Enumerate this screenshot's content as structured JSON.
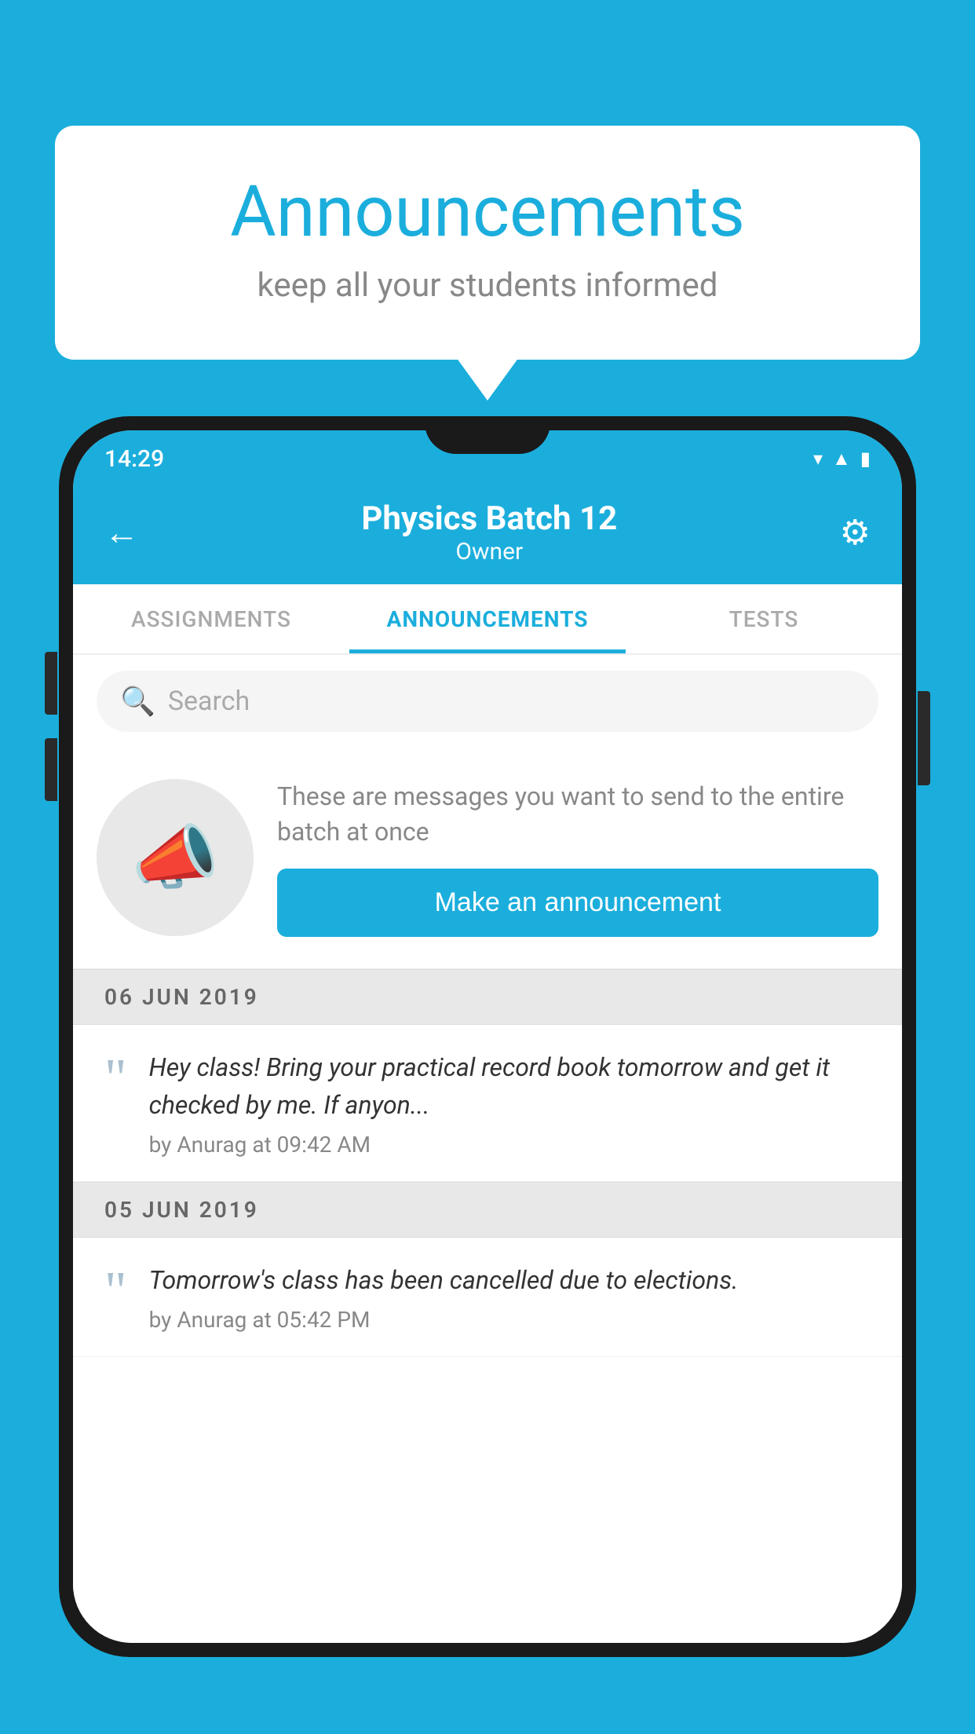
{
  "background_color": "#1BAEDC",
  "speech_bubble": {
    "title": "Announcements",
    "subtitle": "keep all your students informed"
  },
  "phone": {
    "status_bar": {
      "time": "14:29",
      "icons": [
        "wifi",
        "signal",
        "battery"
      ]
    },
    "header": {
      "back_label": "←",
      "title": "Physics Batch 12",
      "subtitle": "Owner",
      "settings_label": "⚙"
    },
    "tabs": [
      {
        "label": "ASSIGNMENTS",
        "active": false
      },
      {
        "label": "ANNOUNCEMENTS",
        "active": true
      },
      {
        "label": "TESTS",
        "active": false
      }
    ],
    "search": {
      "placeholder": "Search"
    },
    "announcement_prompt": {
      "description_text": "These are messages you want to send to the entire batch at once",
      "button_label": "Make an announcement"
    },
    "announcements": [
      {
        "date_header": "06  JUN  2019",
        "text": "Hey class! Bring your practical record book tomorrow and get it checked by me. If anyon...",
        "meta": "by Anurag at 09:42 AM"
      },
      {
        "date_header": "05  JUN  2019",
        "text": "Tomorrow's class has been cancelled due to elections.",
        "meta": "by Anurag at 05:42 PM"
      }
    ]
  }
}
